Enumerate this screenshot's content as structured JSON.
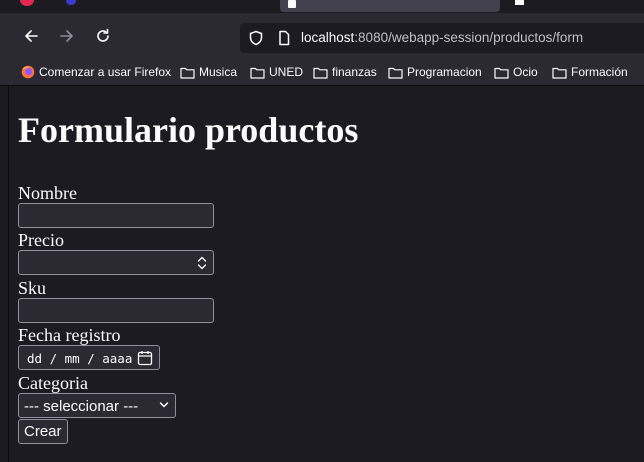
{
  "browser": {
    "url_host": "localhost",
    "url_rest": ":8080/webapp-session/productos/form",
    "bookmarks": [
      {
        "label": "Comenzar a usar Firefox",
        "icon": "firefox-icon"
      },
      {
        "label": "Musica",
        "icon": "folder-icon"
      },
      {
        "label": "UNED",
        "icon": "folder-icon"
      },
      {
        "label": "finanzas",
        "icon": "folder-icon"
      },
      {
        "label": "Programacion",
        "icon": "folder-icon"
      },
      {
        "label": "Ocio",
        "icon": "folder-icon"
      },
      {
        "label": "Formación",
        "icon": "folder-icon"
      }
    ]
  },
  "page": {
    "title": "Formulario productos",
    "fields": {
      "nombre_label": "Nombre",
      "nombre_value": "",
      "precio_label": "Precio",
      "precio_value": "",
      "sku_label": "Sku",
      "sku_value": "",
      "fecha_label": "Fecha registro",
      "fecha_placeholder": "dd / mm / aaaa",
      "categoria_label": "Categoria",
      "categoria_selected": "--- seleccionar ---"
    },
    "submit_label": "Crear"
  },
  "colors": {
    "page_background": "#1c1b22",
    "toolbar_background": "#2b2a33",
    "text": "#fbfbfe",
    "input_border": "#8f8f9d"
  }
}
